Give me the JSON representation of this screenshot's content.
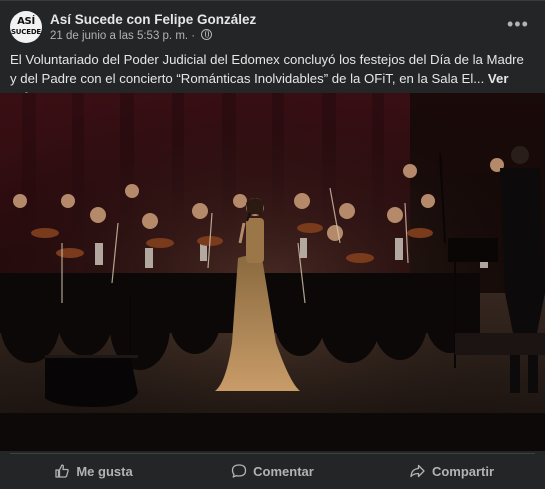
{
  "post": {
    "page_name": "Así Sucede con Felipe González",
    "avatar_line1": "ASÍ",
    "avatar_line2": "SUCEDE",
    "timestamp": "21 de junio a las 5:53 p. m. ·",
    "more_label": "•••",
    "text": "El Voluntariado del Poder Judicial del Edomex concluyó los festejos del Día de la Madre y del Padre con el concierto “Románticas Inolvidables” de la OFiT, en la Sala El...",
    "see_more": "Ver más"
  },
  "actions": {
    "like": "Me gusta",
    "comment": "Comentar",
    "share": "Compartir"
  },
  "icons": {
    "privacy": "globe-icon",
    "like": "thumbs-up-icon",
    "comment": "comment-bubble-icon",
    "share": "share-arrow-icon",
    "more": "more-dots-icon"
  },
  "colors": {
    "background": "#242526",
    "text_primary": "#e4e6eb",
    "text_secondary": "#b0b3b8",
    "stage_curtain": "#5a1a22",
    "gown": "#b08a5a"
  }
}
